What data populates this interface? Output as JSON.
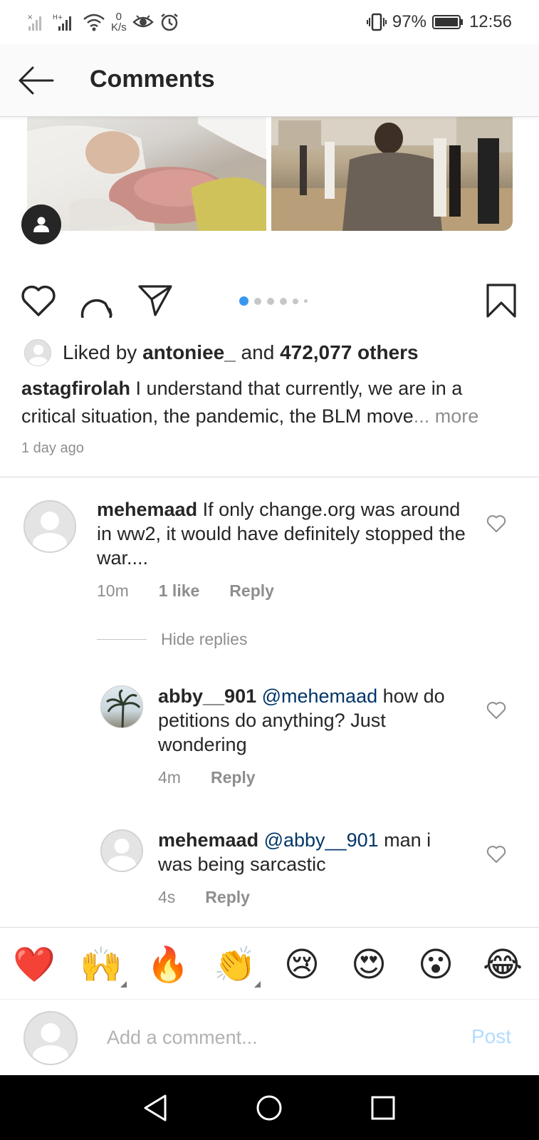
{
  "status_bar": {
    "speed_value": "0",
    "speed_unit": "K/s",
    "battery": "97%",
    "time": "12:56"
  },
  "header": {
    "title": "Comments",
    "back_icon": "arrow-left-icon"
  },
  "post": {
    "carousel_dots": 6,
    "carousel_active_index": 0,
    "likes": {
      "prefix": "Liked by ",
      "first_liker": "antoniee_",
      "connector": " and ",
      "others": "472,077 others"
    },
    "caption": {
      "username": "astagfirolah",
      "text": " I understand that currently, we are in a critical situation, the pandemic, the BLM move",
      "more": "... more"
    },
    "time_ago": "1 day ago"
  },
  "comments": [
    {
      "username": "mehemaad",
      "text": " If only change.org was around in ww2, it would have definitely stopped the war....",
      "time": "10m",
      "likes": "1 like",
      "reply": "Reply"
    }
  ],
  "hide_replies": "Hide replies",
  "replies": [
    {
      "username": "abby__901",
      "mention": " @mehemaad",
      "text": " how do petitions do anything? Just wondering",
      "time": "4m",
      "reply": "Reply"
    },
    {
      "username": "mehemaad",
      "mention": " @abby__901",
      "text": " man i was being sarcastic",
      "time": "4s",
      "reply": "Reply"
    }
  ],
  "emoji_bar": [
    "❤️",
    "🙌",
    "🔥",
    "👏",
    "😢",
    "😍",
    "😮",
    "😂"
  ],
  "comment_input": {
    "placeholder": "Add a comment...",
    "post_label": "Post"
  },
  "colors": {
    "link_blue": "#3897f0",
    "post_disabled": "#b3dbff",
    "mention": "#003569",
    "secondary_text": "#8e8e8e"
  }
}
